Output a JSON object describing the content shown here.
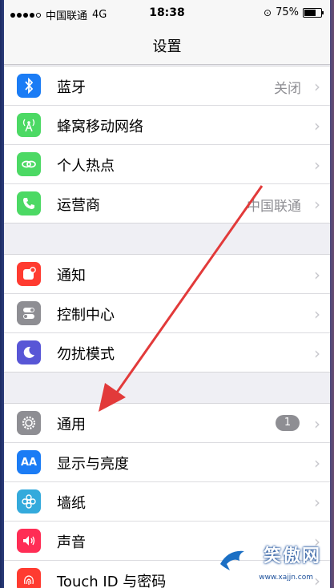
{
  "status": {
    "carrier": "中国联通",
    "network": "4G",
    "time": "18:38",
    "battery": "75%",
    "battery_level": 0.75
  },
  "nav": {
    "title": "设置"
  },
  "groups": [
    {
      "rows": [
        {
          "label": "蓝牙",
          "value": "关闭",
          "icon": "bluetooth-icon",
          "color": "#1b7cf5"
        },
        {
          "label": "蜂窝移动网络",
          "value": "",
          "icon": "cellular-icon",
          "color": "#4cd964"
        },
        {
          "label": "个人热点",
          "value": "",
          "icon": "hotspot-icon",
          "color": "#4cd964"
        },
        {
          "label": "运营商",
          "value": "中国联通",
          "icon": "phone-icon",
          "color": "#4cd964"
        }
      ]
    },
    {
      "rows": [
        {
          "label": "通知",
          "icon": "notifications-icon",
          "color": "#ff3b30"
        },
        {
          "label": "控制中心",
          "icon": "control-center-icon",
          "color": "#8e8e93"
        },
        {
          "label": "勿扰模式",
          "icon": "moon-icon",
          "color": "#5856d6"
        }
      ]
    },
    {
      "rows": [
        {
          "label": "通用",
          "badge": "1",
          "icon": "gear-icon",
          "color": "#8e8e93"
        },
        {
          "label": "显示与亮度",
          "icon": "display-icon",
          "color": "#1b7cf5"
        },
        {
          "label": "墙纸",
          "icon": "wallpaper-icon",
          "color": "#34aadc"
        },
        {
          "label": "声音",
          "icon": "sound-icon",
          "color": "#ff2d55"
        },
        {
          "label": "Touch ID 与密码",
          "icon": "fingerprint-icon",
          "color": "#ff3b30"
        }
      ]
    }
  ],
  "watermark": {
    "text": "笑傲网",
    "url": "www.xajjn.com"
  },
  "colors": {
    "accent": "#e23a3a",
    "group_bg": "#efeff4"
  }
}
